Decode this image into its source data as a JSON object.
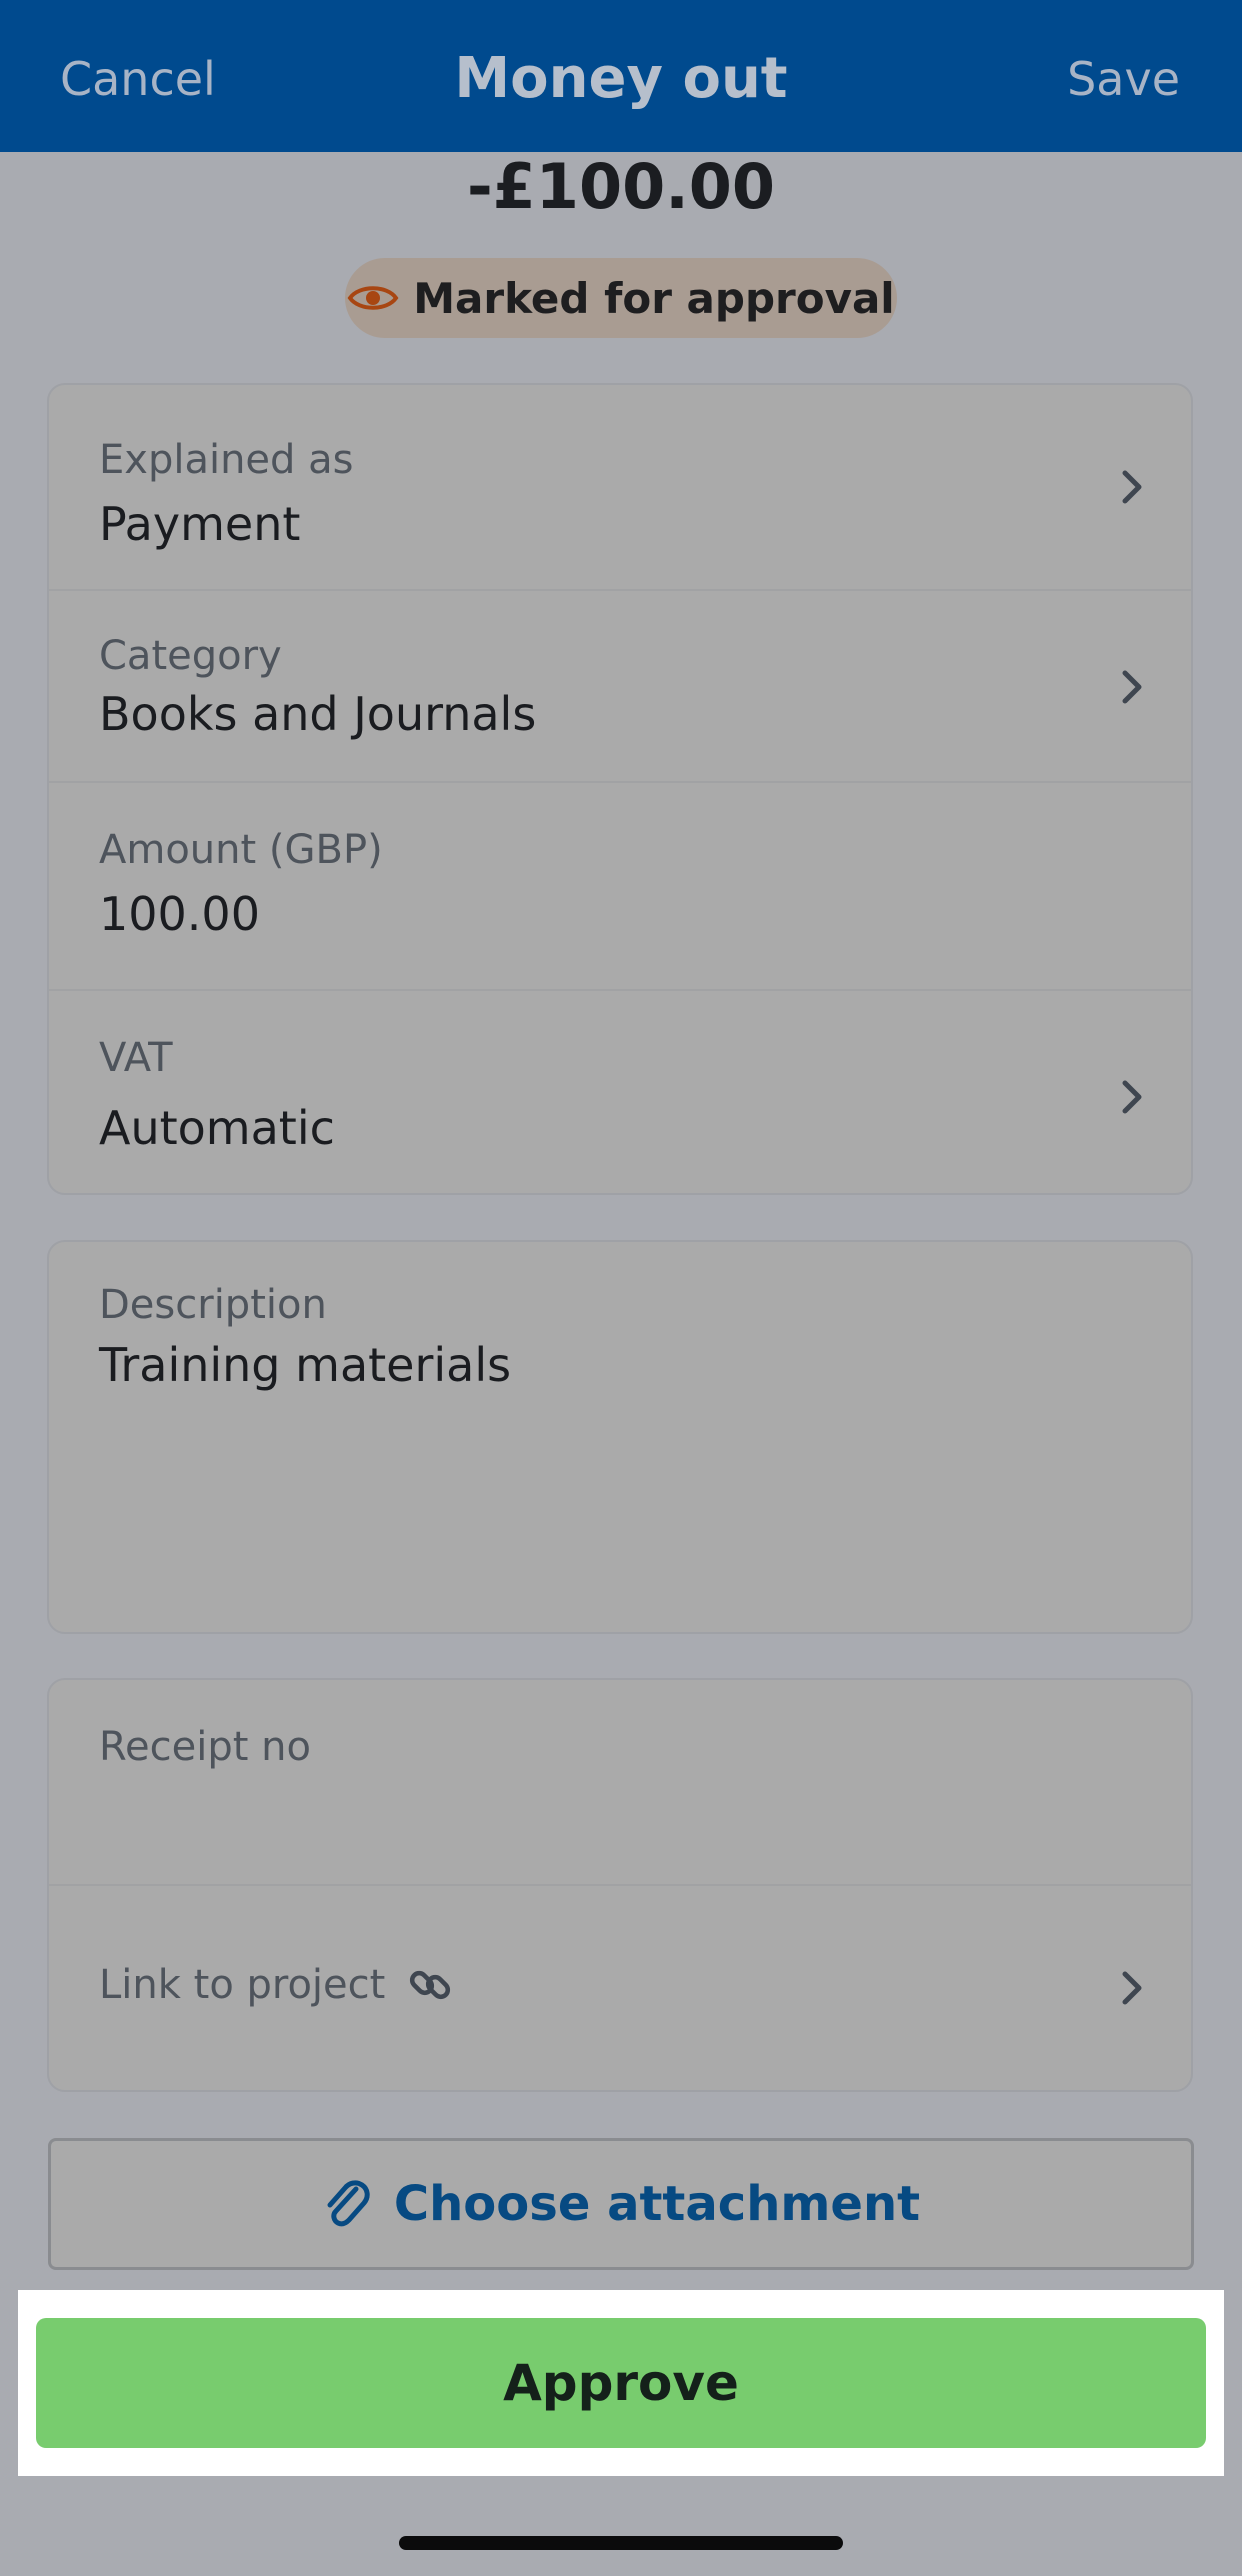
{
  "nav": {
    "cancel": "Cancel",
    "title": "Money out",
    "save": "Save"
  },
  "amount_heading": "-£100.00",
  "status": {
    "label": "Marked for approval",
    "icon": "eye-icon",
    "color": "#a84612"
  },
  "details": {
    "explained_as": {
      "label": "Explained as",
      "value": "Payment"
    },
    "category": {
      "label": "Category",
      "value": "Books and Journals"
    },
    "amount": {
      "label": "Amount (GBP)",
      "value": "100.00"
    },
    "vat": {
      "label": "VAT",
      "value": "Automatic"
    }
  },
  "description": {
    "label": "Description",
    "value": "Training materials"
  },
  "extra": {
    "receipt_label": "Receipt no",
    "receipt_value": "",
    "link_project_label": "Link to project",
    "link_icon": "link-icon"
  },
  "attach": {
    "label": "Choose attachment",
    "icon": "paperclip-icon"
  },
  "approve": {
    "label": "Approve",
    "color": "#78cc6e"
  }
}
